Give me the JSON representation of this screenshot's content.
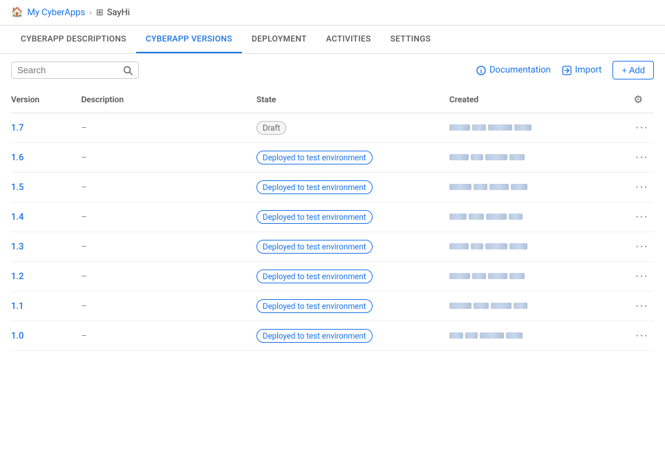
{
  "breadcrumb": {
    "home_label": "My CyberApps",
    "current_label": "SayHi"
  },
  "tabs": [
    {
      "id": "descriptions",
      "label": "CYBERAPP DESCRIPTIONS",
      "active": false
    },
    {
      "id": "versions",
      "label": "CYBERAPP VERSIONS",
      "active": true
    },
    {
      "id": "deployment",
      "label": "DEPLOYMENT",
      "active": false
    },
    {
      "id": "activities",
      "label": "ACTIVITIES",
      "active": false
    },
    {
      "id": "settings",
      "label": "SETTINGS",
      "active": false
    }
  ],
  "toolbar": {
    "search_placeholder": "Search",
    "documentation_label": "Documentation",
    "import_label": "Import",
    "add_label": "+ Add"
  },
  "table": {
    "columns": [
      "Version",
      "Description",
      "State",
      "Created"
    ],
    "rows": [
      {
        "version": "1.7",
        "description": "–",
        "state": "Draft",
        "state_type": "draft"
      },
      {
        "version": "1.6",
        "description": "–",
        "state": "Deployed to test environment",
        "state_type": "deployed"
      },
      {
        "version": "1.5",
        "description": "–",
        "state": "Deployed to test environment",
        "state_type": "deployed"
      },
      {
        "version": "1.4",
        "description": "–",
        "state": "Deployed to test environment",
        "state_type": "deployed"
      },
      {
        "version": "1.3",
        "description": "–",
        "state": "Deployed to test environment",
        "state_type": "deployed"
      },
      {
        "version": "1.2",
        "description": "–",
        "state": "Deployed to test environment",
        "state_type": "deployed"
      },
      {
        "version": "1.1",
        "description": "–",
        "state": "Deployed to test environment",
        "state_type": "deployed"
      },
      {
        "version": "1.0",
        "description": "–",
        "state": "Deployed to test environment",
        "state_type": "deployed"
      }
    ]
  }
}
